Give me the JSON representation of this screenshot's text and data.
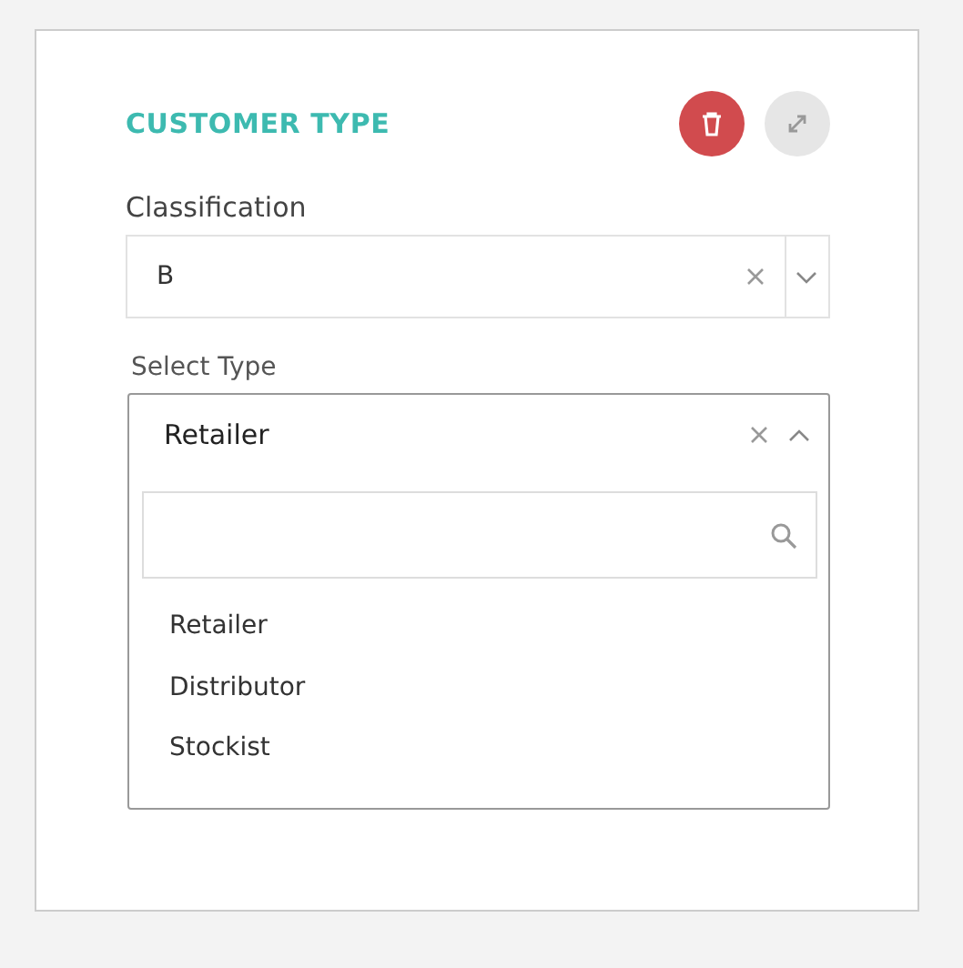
{
  "panel": {
    "title": "CUSTOMER TYPE"
  },
  "classification": {
    "label": "Classification",
    "value": "B",
    "open": false
  },
  "select_type": {
    "label": "Select Type",
    "value": "Retailer",
    "open": true,
    "options": [
      {
        "label": "Retailer"
      },
      {
        "label": "Distributor"
      },
      {
        "label": "Stockist"
      }
    ]
  }
}
